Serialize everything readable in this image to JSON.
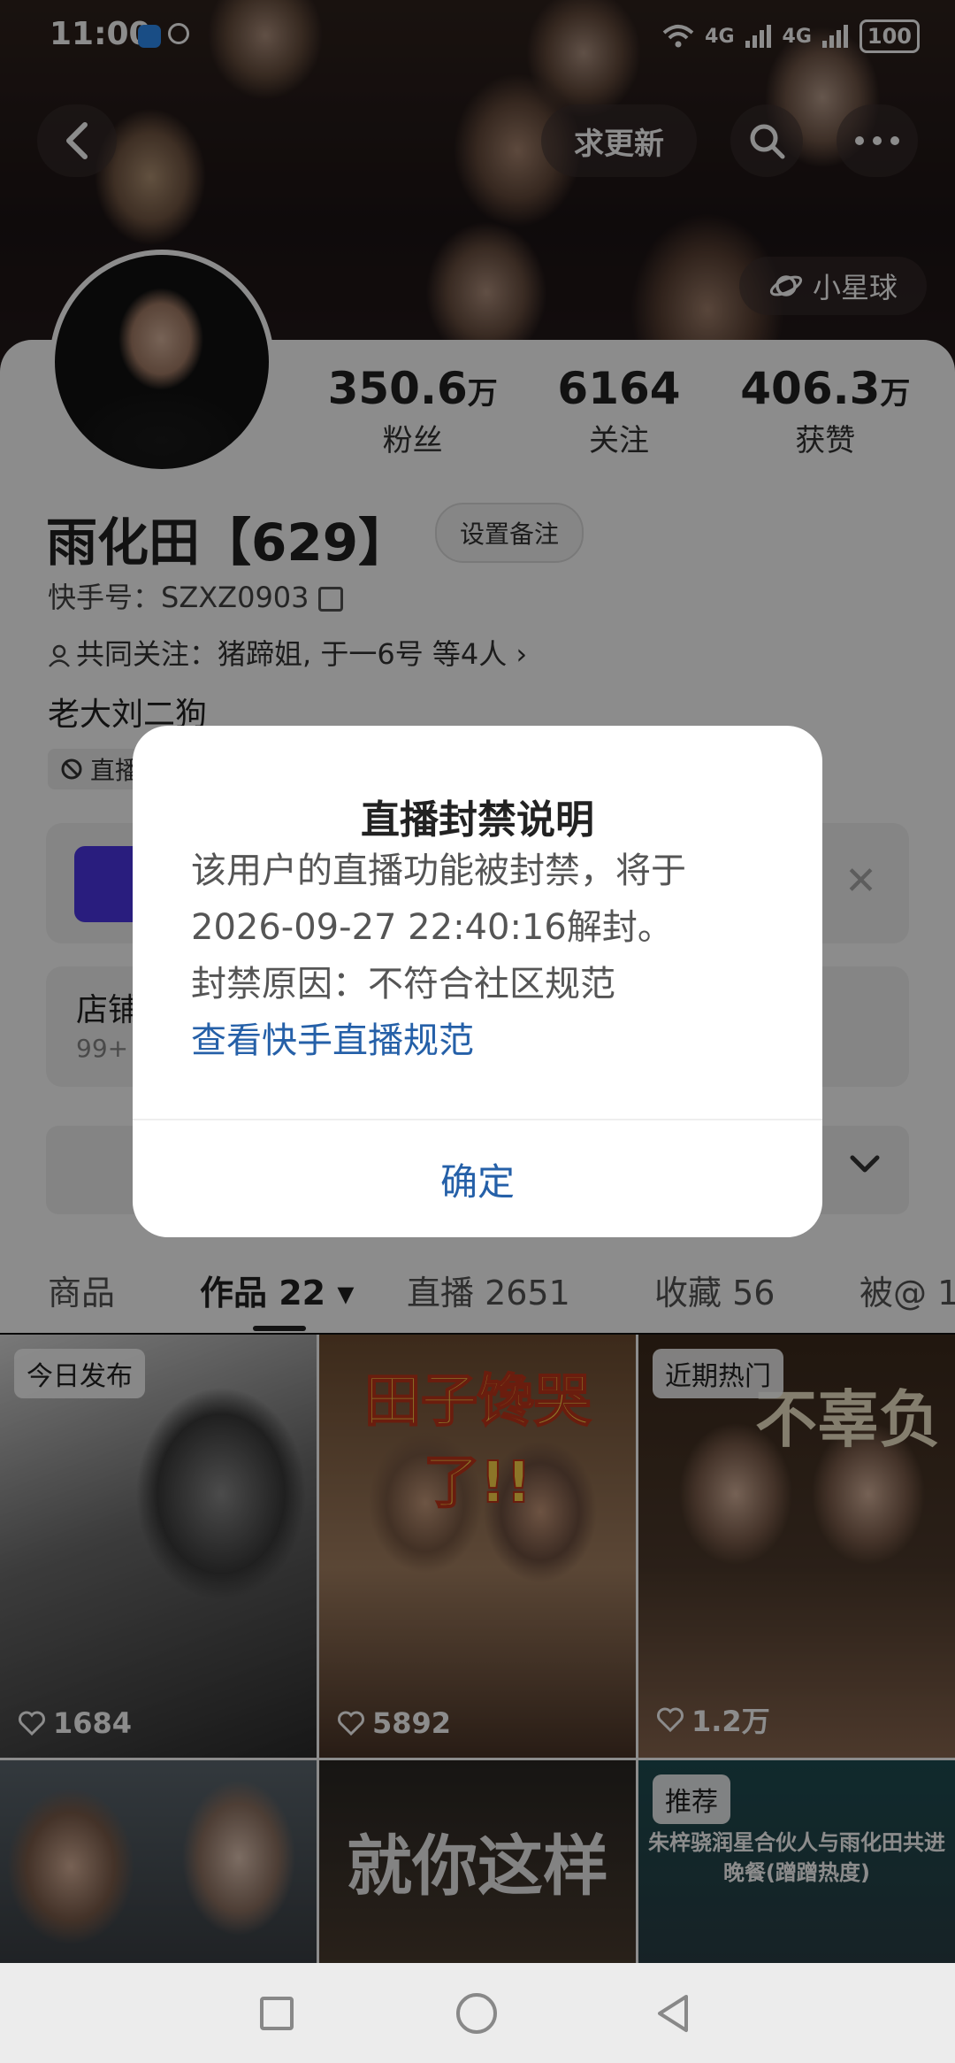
{
  "status_bar": {
    "time": "11:00",
    "signal_1": "4G",
    "signal_2": "4G",
    "battery": "100"
  },
  "top_nav": {
    "update_label": "求更新",
    "planet_label": "小星球"
  },
  "profile": {
    "stats": [
      {
        "value": "350.6",
        "unit": "万",
        "label": "粉丝"
      },
      {
        "value": "6164",
        "unit": "",
        "label": "关注"
      },
      {
        "value": "406.3",
        "unit": "万",
        "label": "获赞"
      }
    ],
    "name": "雨化田【629】",
    "remark_button": "设置备注",
    "kuaishou_id": "快手号：SZXZ0903",
    "mutual_follow": "共同关注：猪蹄姐, 于一6号 等4人",
    "bio": "老大刘二狗",
    "live_tag": "直播"
  },
  "shop": {
    "title": "店铺",
    "subtitle": "99+"
  },
  "tabs": [
    {
      "label": "商品"
    },
    {
      "label": "作品 22 ▾"
    },
    {
      "label": "直播 2651"
    },
    {
      "label": "收藏 56"
    },
    {
      "label": "被@ 1"
    }
  ],
  "grid": [
    {
      "tag": "今日发布",
      "likes": "1684",
      "title": ""
    },
    {
      "tag": "",
      "likes": "5892",
      "title": "田子馋哭了!!"
    },
    {
      "tag": "近期热门",
      "likes": "1.2万",
      "title": "不辜负"
    },
    {
      "tag": "",
      "likes": "",
      "title": ""
    },
    {
      "tag": "",
      "likes": "",
      "title": "就你这样"
    },
    {
      "tag": "推荐",
      "likes": "",
      "title": "朱梓骁润星合伙人与雨化田共进晚餐(蹭蹭热度)"
    }
  ],
  "dialog": {
    "title": "直播封禁说明",
    "body_line1": "该用户的直播功能被封禁，将于",
    "body_line2": "2026-09-27 22:40:16解封。",
    "body_line3": "封禁原因：不符合社区规范",
    "link": "查看快手直播规范",
    "ok_button": "确定"
  },
  "colors": {
    "link_blue": "#2560a8",
    "promo_logo": "#4b36e6"
  }
}
